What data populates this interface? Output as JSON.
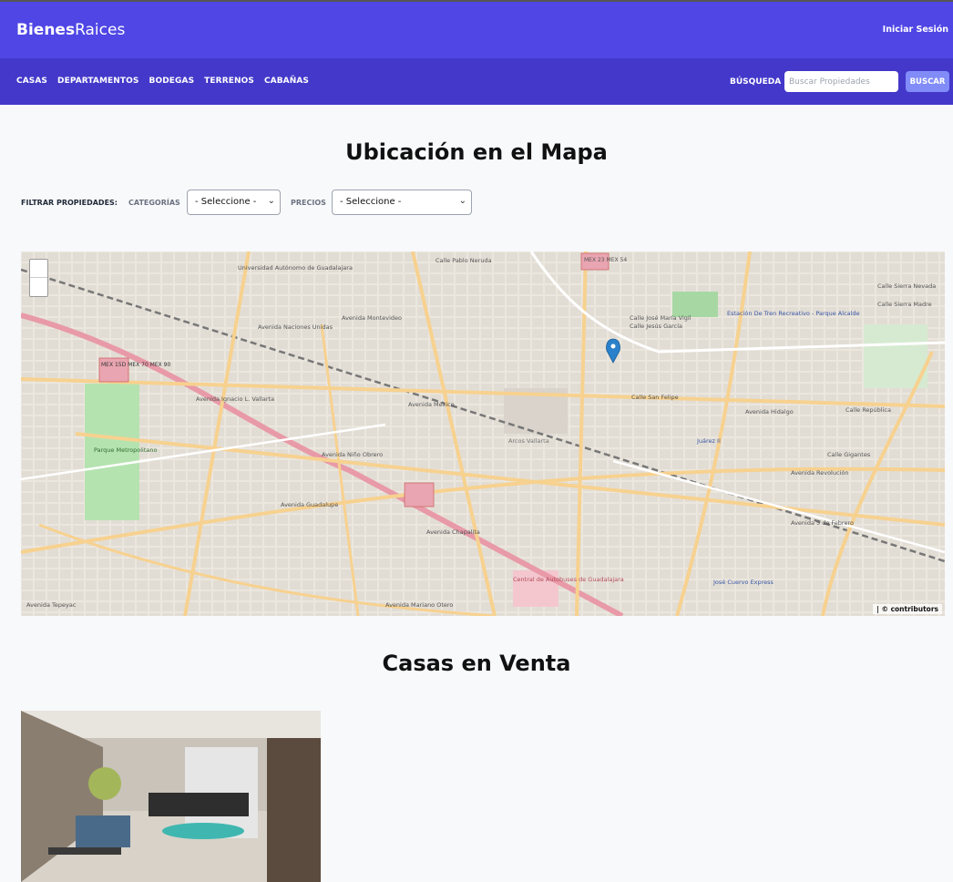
{
  "header": {
    "brand_bold": "Bienes",
    "brand_light": "Raices",
    "login_label": "Iniciar Sesión"
  },
  "nav": {
    "links": [
      "CASAS",
      "DEPARTAMENTOS",
      "BODEGAS",
      "TERRENOS",
      "CABAÑAS"
    ],
    "search_label": "BÚSQUEDA",
    "search_placeholder": "Buscar Propiedades",
    "search_button": "BUSCAR"
  },
  "map_section": {
    "title": "Ubicación en el Mapa",
    "filter_label": "FILTRAR PROPIEDADES:",
    "categories_label": "CATEGORÍAS",
    "categories_value": "- Seleccione -",
    "prices_label": "PRECIOS",
    "prices_value": "- Seleccione -"
  },
  "map": {
    "attribution": "| © contributors",
    "labels": [
      "Universidad Autónomo de Guadalajara",
      "Calle Pablo Neruda",
      "MEX 23 MEX 54",
      "Calle José María Vigil",
      "Calle Jesús García",
      "Estación De Tren Recreativo - Parque Alcalde",
      "Calle Sierra Nevada",
      "Calle Sierra Madre",
      "Avenida Naciones Unidas",
      "Avenida Montevideo",
      "Avenida Ignacio L. Vallarta",
      "MEX 15D MEX 70 MEX 90",
      "Avenida México",
      "Calle San Felipe",
      "Avenida Hidalgo",
      "Calle República",
      "Parque Metropolitano",
      "Arcos Vallarta",
      "Juárez II",
      "Calle Gigantes",
      "Avenida Revolución",
      "Avenida Guadalupe",
      "Avenida Niño Obrero",
      "Avenida Chapalita",
      "Central de Autobuses de Guadalajara",
      "José Cuervo Express",
      "Avenida Tepeyac",
      "Avenida Mariano Otero",
      "Avenida 5 de Febrero"
    ]
  },
  "listings_section": {
    "title": "Casas en Venta"
  },
  "colors": {
    "header_bg": "#4f46e5",
    "nav_bg": "#4338ca",
    "search_button_bg": "#818cf8",
    "marker": "#2a81cb"
  }
}
